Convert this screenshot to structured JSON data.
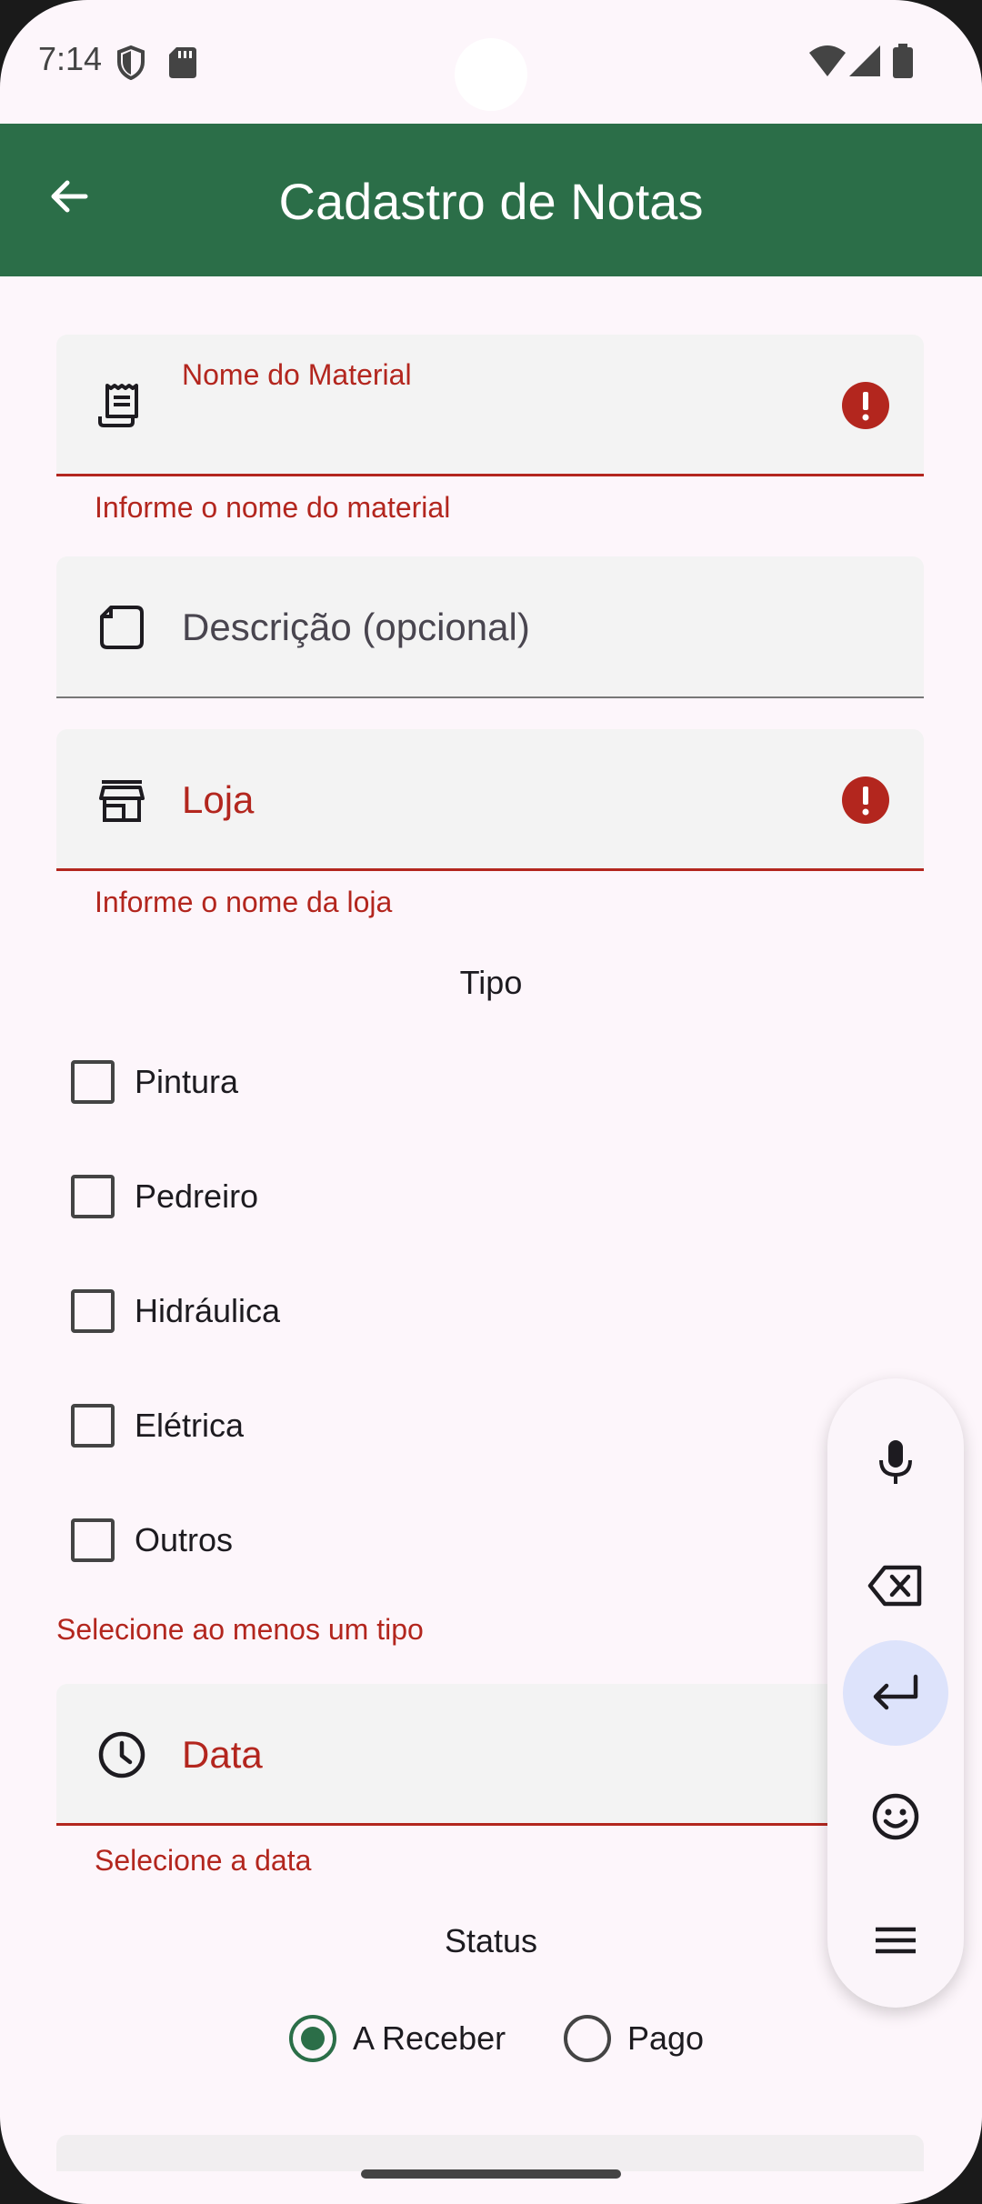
{
  "status_bar": {
    "time": "7:14"
  },
  "app_bar": {
    "title": "Cadastro de Notas"
  },
  "form": {
    "material": {
      "label": "Nome do Material",
      "value": "",
      "error": "Informe o nome do material",
      "icon": "receipt-icon"
    },
    "descricao": {
      "placeholder": "Descrição (opcional)",
      "icon": "note-icon"
    },
    "loja": {
      "placeholder": "Loja",
      "error": "Informe o nome da loja",
      "icon": "store-icon"
    },
    "tipo": {
      "title": "Tipo",
      "options": [
        {
          "label": "Pintura",
          "checked": false
        },
        {
          "label": "Pedreiro",
          "checked": false
        },
        {
          "label": "Hidráulica",
          "checked": false
        },
        {
          "label": "Elétrica",
          "checked": false
        },
        {
          "label": "Outros",
          "checked": false
        }
      ],
      "error": "Selecione ao menos um tipo"
    },
    "data": {
      "placeholder": "Data",
      "error": "Selecione a data",
      "icon": "clock-icon"
    },
    "status": {
      "title": "Status",
      "options": [
        {
          "label": "A Receber",
          "selected": true
        },
        {
          "label": "Pago",
          "selected": false
        }
      ]
    }
  },
  "floating_toolbar": {
    "buttons": [
      "mic-icon",
      "backspace-icon",
      "enter-icon",
      "emoji-icon",
      "menu-icon"
    ],
    "active": "enter-icon"
  },
  "colors": {
    "primary": "#2b6e48",
    "error": "#b3261e",
    "background": "#fdf6fb",
    "field_bg": "#f3f3f3"
  }
}
